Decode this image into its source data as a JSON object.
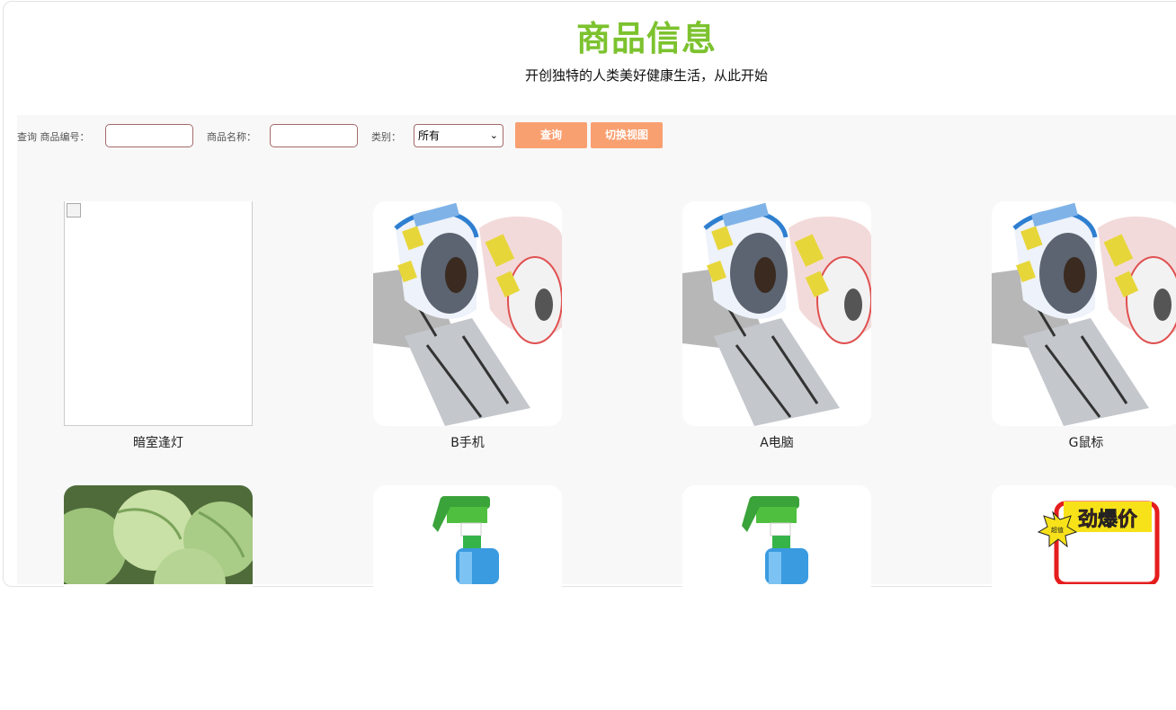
{
  "header": {
    "title": "商品信息",
    "subtitle": "开创独特的人类美好健康生活，从此开始"
  },
  "search": {
    "query_label": "查询 商品编号：",
    "product_id_value": "",
    "name_label": "商品名称：",
    "name_value": "",
    "category_label": "类别：",
    "category_selected": "所有",
    "query_button": "查询",
    "switch_view_button": "切换视图"
  },
  "products": [
    {
      "name": "暗室逢灯",
      "image": "broken-image-icon"
    },
    {
      "name": "B手机",
      "image": "label-rolls-image"
    },
    {
      "name": "A电脑",
      "image": "label-rolls-image"
    },
    {
      "name": "G鼠标",
      "image": "label-rolls-image"
    },
    {
      "name": "",
      "image": "cabbage-image"
    },
    {
      "name": "",
      "image": "spray-bottle-image"
    },
    {
      "name": "",
      "image": "spray-bottle-image"
    },
    {
      "name": "",
      "image": "price-tag-image"
    }
  ],
  "tag_text": {
    "big": "劲爆价",
    "small": "超值"
  },
  "colors": {
    "title": "#7cc22e",
    "button": "#f9a071",
    "input_border": "#a56a6a"
  }
}
